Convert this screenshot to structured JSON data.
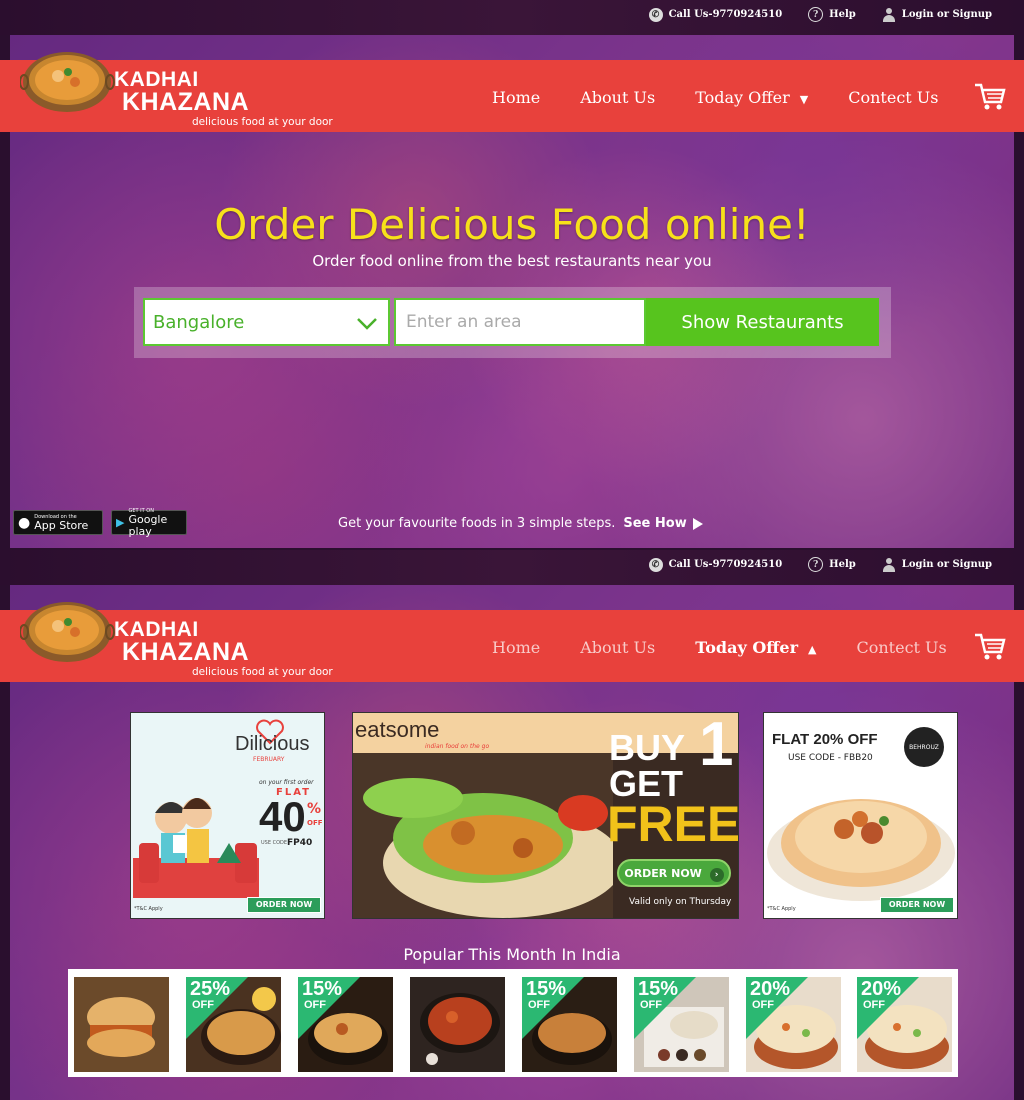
{
  "topbar": {
    "call": "Call Us-9770924510",
    "help": "Help",
    "login": "Login or Signup"
  },
  "brand": {
    "line1": "KADHAI",
    "line2": "KHAZANA",
    "tagline": "delicious food at your door"
  },
  "nav": {
    "home": "Home",
    "about": "About Us",
    "offer": "Today Offer",
    "contact": "Contect Us"
  },
  "hero": {
    "title": "Order Delicious Food online!",
    "subtitle": "Order food online from the best restaurants near you",
    "city": "Bangalore",
    "area_placeholder": "Enter an area",
    "button": "Show Restaurants"
  },
  "apps": {
    "appstore_small": "Download on the",
    "appstore_big": "App Store",
    "google_small": "GET IT ON",
    "google_big": "Google play"
  },
  "steps": {
    "text": "Get your favourite foods in 3 simple steps.",
    "link": "See How"
  },
  "offers": {
    "o1": {
      "brand": "Dilicious",
      "sub": "FEBRUARY",
      "first": "on your first order",
      "flat": "FLAT",
      "pct": "40",
      "pctsign": "%",
      "offword": "OFF",
      "code_label": "USE CODE",
      "code": "FP40",
      "tc": "*T&C Apply",
      "order": "ORDER NOW"
    },
    "o2": {
      "brand": "eatsome",
      "tag": "indian food on the go",
      "buy": "BUY",
      "one": "1",
      "get": "GET",
      "free": "FREE",
      "order": "ORDER NOW",
      "valid": "Valid only on Thursday"
    },
    "o3": {
      "headline": "FLAT 20% OFF",
      "code": "USE CODE - FBB20",
      "badge": "BEHROUZ",
      "tc": "*T&C Apply",
      "order": "ORDER NOW"
    }
  },
  "popular": {
    "title": "Popular This Month In India",
    "items": [
      {
        "pct": "",
        "off": ""
      },
      {
        "pct": "25%",
        "off": "OFF"
      },
      {
        "pct": "15%",
        "off": "OFF"
      },
      {
        "pct": "",
        "off": ""
      },
      {
        "pct": "15%",
        "off": "OFF"
      },
      {
        "pct": "15%",
        "off": "OFF"
      },
      {
        "pct": "20%",
        "off": "OFF"
      },
      {
        "pct": "20%",
        "off": "OFF"
      }
    ]
  },
  "colors": {
    "nav_red": "#e8413c",
    "hero_yellow": "#f7e11a",
    "green": "#57c41e",
    "offer_green": "#2bb872"
  }
}
